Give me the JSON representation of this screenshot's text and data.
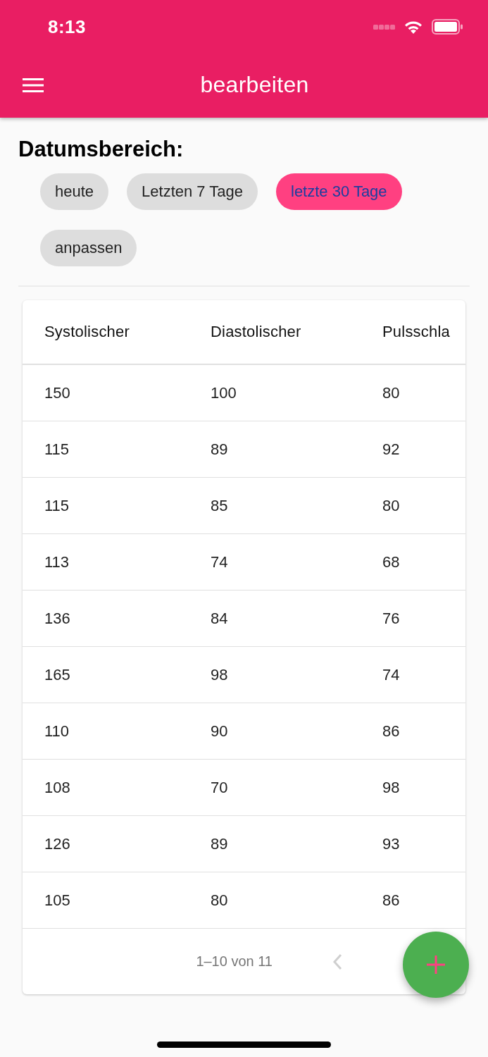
{
  "status_bar": {
    "time": "8:13"
  },
  "app_bar": {
    "title": "bearbeiten"
  },
  "date_range": {
    "label": "Datumsbereich:",
    "chips": [
      {
        "label": "heute",
        "selected": false
      },
      {
        "label": "Letzten 7 Tage",
        "selected": false
      },
      {
        "label": "letzte 30 Tage",
        "selected": true
      },
      {
        "label": "anpassen",
        "selected": false
      }
    ]
  },
  "table": {
    "columns": [
      "Systolischer",
      "Diastolischer",
      "Pulsschla"
    ],
    "rows": [
      [
        "150",
        "100",
        "80"
      ],
      [
        "115",
        "89",
        "92"
      ],
      [
        "115",
        "85",
        "80"
      ],
      [
        "113",
        "74",
        "68"
      ],
      [
        "136",
        "84",
        "76"
      ],
      [
        "165",
        "98",
        "74"
      ],
      [
        "110",
        "90",
        "86"
      ],
      [
        "108",
        "70",
        "98"
      ],
      [
        "126",
        "89",
        "93"
      ],
      [
        "105",
        "80",
        "86"
      ]
    ]
  },
  "pagination": {
    "range": "1–10 von 11",
    "previous_disabled": true
  }
}
